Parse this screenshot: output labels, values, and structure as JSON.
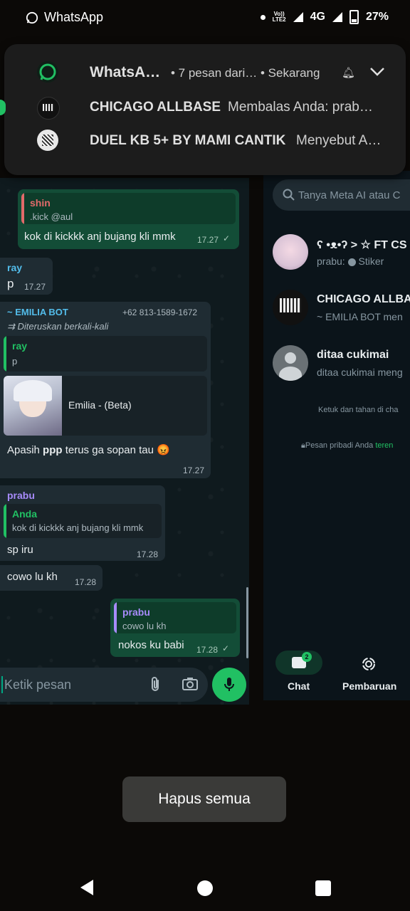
{
  "status_bar": {
    "app_name": "WhatsApp",
    "network_top": "Vo))",
    "network_bottom": "LTE2",
    "network_type": "4G",
    "battery": "27%"
  },
  "notification": {
    "app": "WhatsA…",
    "summary": "• 7 pesan dari…",
    "time": "• Sekarang",
    "rows": [
      {
        "title": "CHICAGO ALLBASE",
        "text": "Membalas Anda: prab…"
      },
      {
        "title": "DUEL KB 5+ BY MAMI CANTIK",
        "text": "Menyebut A…"
      }
    ]
  },
  "chat": {
    "messages": {
      "shin": {
        "quote_name": "shin",
        "quote_text": ".kick @aul",
        "text": "kok di kickkk anj bujang kli mmk",
        "time": "17.27"
      },
      "ray": {
        "sender": "ray",
        "text": "p",
        "time": "17.27"
      },
      "bot": {
        "sender": "~ EMILIA BOT",
        "phone": "+62 813-1589-1672",
        "forwarded": "Diteruskan berkali-kali",
        "quote_name": "ray",
        "quote_text": "p",
        "card_title": "Emilia - (Beta)",
        "text_prefix": "Apasih ",
        "text_bold": "ppp",
        "text_suffix": " terus ga sopan tau",
        "emoji": "😡",
        "time": "17.27"
      },
      "prabu1": {
        "sender": "prabu",
        "quote_name": "Anda",
        "quote_text": "kok di kickkk anj bujang kli mmk",
        "text": "sp iru",
        "time": "17.28"
      },
      "prabu2": {
        "text": "cowo lu kh",
        "time": "17.28"
      },
      "out2": {
        "quote_name": "prabu",
        "quote_text": "cowo lu kh",
        "text": "nokos ku babi",
        "time": "17.28"
      }
    },
    "input_placeholder": "Ketik pesan"
  },
  "chat_list": {
    "search_placeholder": "Tanya Meta AI atau C",
    "rows": [
      {
        "name": "ʕ •ᴥ•ʔ > ☆ FT CS B",
        "sender": "prabu:",
        "msg": "Stiker"
      },
      {
        "name": "CHICAGO ALLBASE",
        "msg": "~ EMILIA BOT men"
      },
      {
        "name": "ditaa cukimai",
        "msg": "ditaa cukimai meng"
      }
    ],
    "hint": "Ketuk dan tahan di cha",
    "privacy": "Pesan pribadi Anda ",
    "privacy_link": "teren",
    "nav": {
      "chat_label": "Chat",
      "chat_badge": "2",
      "updates_label": "Pembaruan"
    }
  },
  "recents": {
    "clear_all": "Hapus semua"
  },
  "colors": {
    "accent": "#21c063",
    "outgoing": "#134d37",
    "incoming": "#1f2c33",
    "bg": "#0b141a"
  }
}
